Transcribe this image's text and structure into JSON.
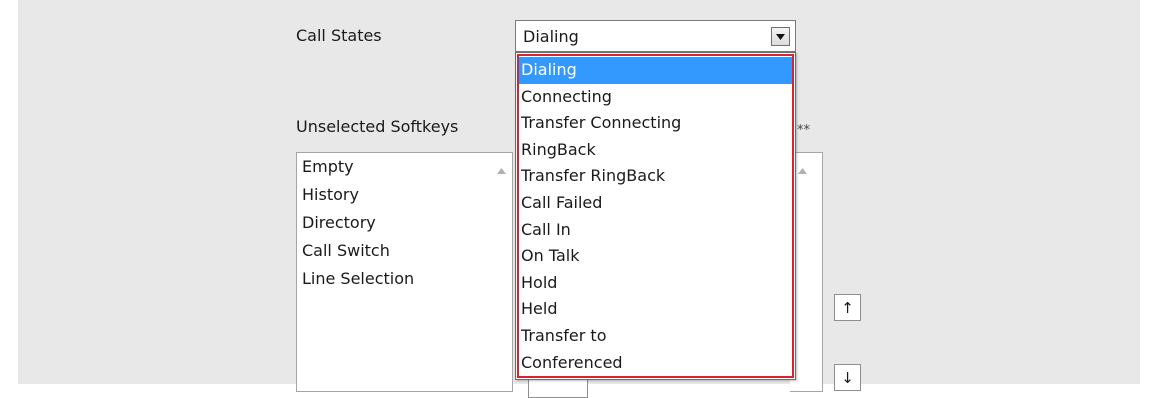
{
  "form": {
    "call_states_label": "Call States",
    "unselected_softkeys_label": "Unselected Softkeys",
    "selected_softkeys_marker": "**"
  },
  "call_state_select": {
    "value": "Dialing",
    "options": [
      "Dialing",
      "Connecting",
      "Transfer Connecting",
      "RingBack",
      "Transfer RingBack",
      "Call Failed",
      "Call In",
      "On Talk",
      "Hold",
      "Held",
      "Transfer to",
      "Conferenced"
    ],
    "selected_index": 0
  },
  "unselected_softkeys": {
    "items": [
      "Empty",
      "History",
      "Directory",
      "Call Switch",
      "Line Selection"
    ]
  },
  "buttons": {
    "move_up": "↑",
    "move_down": "↓"
  },
  "icons": {
    "dropdown_arrow": "chevron-down-icon",
    "scroll_up": "scroll-up-arrow-icon"
  },
  "colors": {
    "panel_bg": "#e8e8e8",
    "selection_bg": "#3399ff",
    "highlight_border": "#d9242c"
  }
}
